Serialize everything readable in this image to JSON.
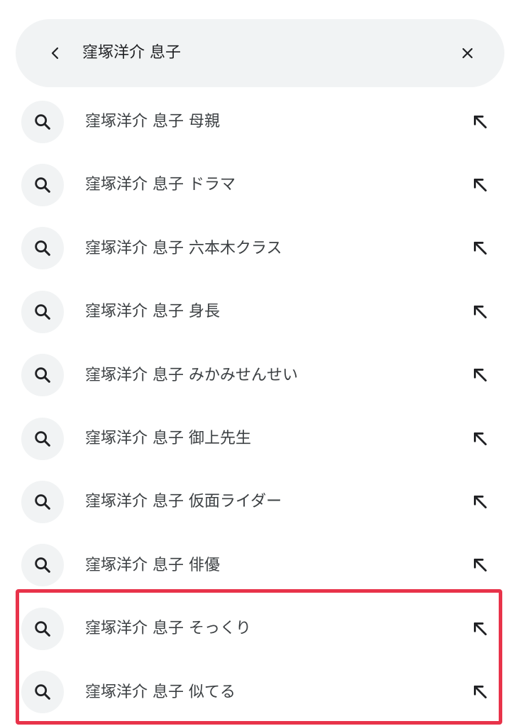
{
  "search": {
    "query": "窪塚洋介 息子",
    "back_icon": "chevron-left-icon",
    "clear_icon": "close-icon"
  },
  "suggestions": [
    {
      "prefix": "窪塚洋介 息子",
      "suffix": "母親"
    },
    {
      "prefix": "窪塚洋介 息子",
      "suffix": "ドラマ"
    },
    {
      "prefix": "窪塚洋介 息子",
      "suffix": "六本木クラス"
    },
    {
      "prefix": "窪塚洋介 息子",
      "suffix": "身長"
    },
    {
      "prefix": "窪塚洋介 息子",
      "suffix": "みかみせんせい"
    },
    {
      "prefix": "窪塚洋介 息子",
      "suffix": "御上先生"
    },
    {
      "prefix": "窪塚洋介 息子",
      "suffix": "仮面ライダー"
    },
    {
      "prefix": "窪塚洋介 息子",
      "suffix": "俳優"
    },
    {
      "prefix": "窪塚洋介 息子",
      "suffix": "そっくり"
    },
    {
      "prefix": "窪塚洋介 息子",
      "suffix": "似てる"
    }
  ],
  "icons": {
    "suggestion_icon": "search-icon",
    "fill_icon": "arrow-up-left-icon"
  },
  "colors": {
    "bar_background": "#f1f3f4",
    "highlight_border": "#e8334a",
    "text": "#3c4043"
  },
  "highlight": {
    "rows": [
      9,
      10
    ]
  }
}
